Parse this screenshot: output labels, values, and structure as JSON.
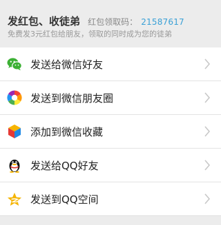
{
  "header": {
    "title": "发红包、收徒弟",
    "code_label": "红包领取码：",
    "code": "21587617",
    "subtitle": "免费发3元红包给朋友，领取的同时成为您的徒弟"
  },
  "share": {
    "items": [
      {
        "label": "发送给微信好友",
        "icon": "wechat-icon"
      },
      {
        "label": "发送到微信朋友圈",
        "icon": "moments-icon"
      },
      {
        "label": "添加到微信收藏",
        "icon": "favorites-cube-icon"
      },
      {
        "label": "发送给QQ好友",
        "icon": "qq-penguin-icon"
      },
      {
        "label": "发送到QQ空间",
        "icon": "qzone-star-icon"
      }
    ]
  },
  "colors": {
    "background": "#ececec",
    "code": "#39a0d6",
    "wechat_green": "#3cb034",
    "qzone_yellow": "#f5b400",
    "chevron": "#c8c8c8"
  }
}
